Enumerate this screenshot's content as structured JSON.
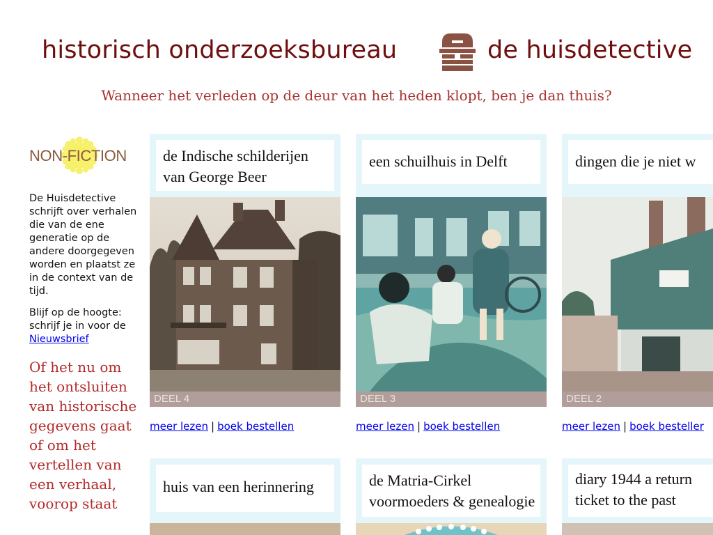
{
  "header": {
    "brand_left": "historisch onderzoeksbureau",
    "brand_right": "de huisdetective",
    "tagline": "Wanneer het verleden op de deur van het heden klopt, ben je dan thuis?",
    "logo_icon": "house-logo-icon",
    "brand_color": "#6e0e0e"
  },
  "sidebar": {
    "badge_text": "NON-FICTION",
    "badge_icon": "sun-badge-icon",
    "intro": "De Huisdetective schrijft over verhalen die van de ene generatie op de andere doorgegeven worden en plaatst ze in de context van de tijd.",
    "signup_text": "Blijf op de hoogte: schrijf je in voor de",
    "signup_link": "Nieuwsbrief",
    "quote": "Of het nu om het ontsluiten van historische gegevens gaat of om het vertellen van een verhaal, voorop staat"
  },
  "cards": [
    {
      "title_line1": "de Indische schilderijen",
      "title_line2": "van George Beer",
      "deel": "DEEL 4",
      "read_more": "meer lezen",
      "order": "boek bestellen",
      "separator": "|"
    },
    {
      "title_line1": "een schuilhuis in Delft",
      "title_line2": "",
      "deel": "DEEL 3",
      "read_more": "meer lezen",
      "order": "boek bestellen",
      "separator": "|"
    },
    {
      "title_line1": "dingen die je niet w",
      "title_line2": "",
      "deel": "DEEL 2",
      "read_more": "meer lezen",
      "order": "boek besteller",
      "separator": "|"
    },
    {
      "title_line1": "huis van een herinnering",
      "title_line2": ""
    },
    {
      "title_line1": "de Matria-Cirkel",
      "title_line2": "voormoeders & genealogie"
    },
    {
      "title_line1": "diary 1944 a return",
      "title_line2": "ticket to the past"
    }
  ]
}
